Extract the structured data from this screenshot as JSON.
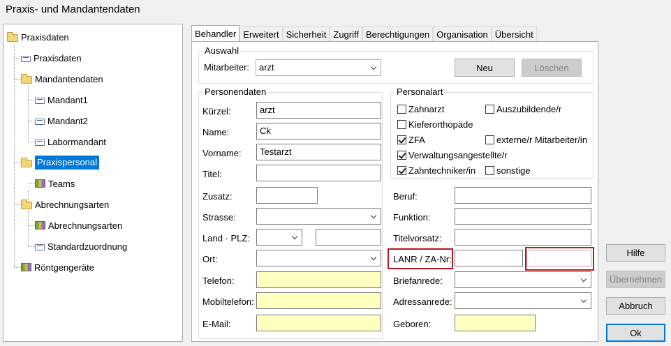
{
  "window": {
    "title": "Praxis- und Mandantendaten"
  },
  "tree": [
    {
      "label": "Praxisdaten",
      "icon": "folder-open-icon"
    },
    {
      "label": "Praxisdaten",
      "icon": "list-icon"
    },
    {
      "label": "Mandantendaten",
      "icon": "folder-open-icon"
    },
    {
      "label": "Mandant1",
      "icon": "list-icon"
    },
    {
      "label": "Mandant2",
      "icon": "list-icon"
    },
    {
      "label": "Labormandant",
      "icon": "list-icon"
    },
    {
      "label": "Praxispersonal",
      "icon": "folder-open-icon",
      "selected": true
    },
    {
      "label": "Teams",
      "icon": "books-icon"
    },
    {
      "label": "Abrechnungsarten",
      "icon": "folder-open-icon"
    },
    {
      "label": "Abrechnungsarten",
      "icon": "books-icon"
    },
    {
      "label": "Standardzuordnung",
      "icon": "list-icon"
    },
    {
      "label": "Röntgengeräte",
      "icon": "books-icon"
    }
  ],
  "tabs": [
    "Behandler",
    "Erweitert",
    "Sicherheit",
    "Zugriff",
    "Berechtigungen",
    "Organisation",
    "Übersicht"
  ],
  "auswahl": {
    "legend": "Auswahl",
    "mitarbeiter_label": "Mitarbeiter:",
    "mitarbeiter_value": "arzt",
    "neu": "Neu",
    "loeschen": "Löschen"
  },
  "personendaten": {
    "legend": "Personendaten",
    "kuerzel_label": "Kürzel:",
    "kuerzel": "arzt",
    "name_label": "Name:",
    "name": "Ck",
    "vorname_label": "Vorname:",
    "vorname": "Testarzt",
    "titel_label": "Titel:",
    "titel": "",
    "zusatz_label": "Zusatz:",
    "zusatz": "",
    "strasse_label": "Strasse:",
    "strasse": "",
    "land_plz_label": "Land · PLZ:",
    "land": "",
    "plz": "",
    "ort_label": "Ort:",
    "ort": "",
    "telefon_label": "Telefon:",
    "telefon": "",
    "mobil_label": "Mobiltelefon:",
    "mobil": "",
    "email_label": "E-Mail:",
    "email": ""
  },
  "personalart": {
    "legend": "Personalart",
    "items": [
      {
        "label": "Zahnarzt",
        "checked": false
      },
      {
        "label": "Auszubildende/r",
        "checked": false
      },
      {
        "label": "Kieferorthopäde",
        "checked": false
      },
      {
        "label": "ZFA",
        "checked": true
      },
      {
        "label": "externe/r Mitarbeiter/in",
        "checked": false
      },
      {
        "label": "Verwaltungsangestellte/r",
        "checked": true
      },
      {
        "label": "Zahntechniker/in",
        "checked": true
      },
      {
        "label": "sonstige",
        "checked": false
      }
    ]
  },
  "right": {
    "beruf_label": "Beruf:",
    "beruf": "",
    "funktion_label": "Funktion:",
    "funktion": "",
    "titelvorsatz_label": "Titelvorsatz:",
    "titelvorsatz": "",
    "lanr_label": "LANR / ZA-Nr:",
    "lanr": "",
    "zanr": "",
    "briefanrede_label": "Briefanrede:",
    "briefanrede": "",
    "adressanrede_label": "Adressanrede:",
    "adressanrede": "",
    "geboren_label": "Geboren:",
    "geboren": ""
  },
  "buttons": {
    "hilfe": "Hilfe",
    "uebernehmen": "Übernehmen",
    "abbruch": "Abbruch",
    "ok": "Ok"
  },
  "colors": {
    "selection": "#0078d7",
    "highlight_box": "#c0141e",
    "required_field": "#ffffc0"
  }
}
